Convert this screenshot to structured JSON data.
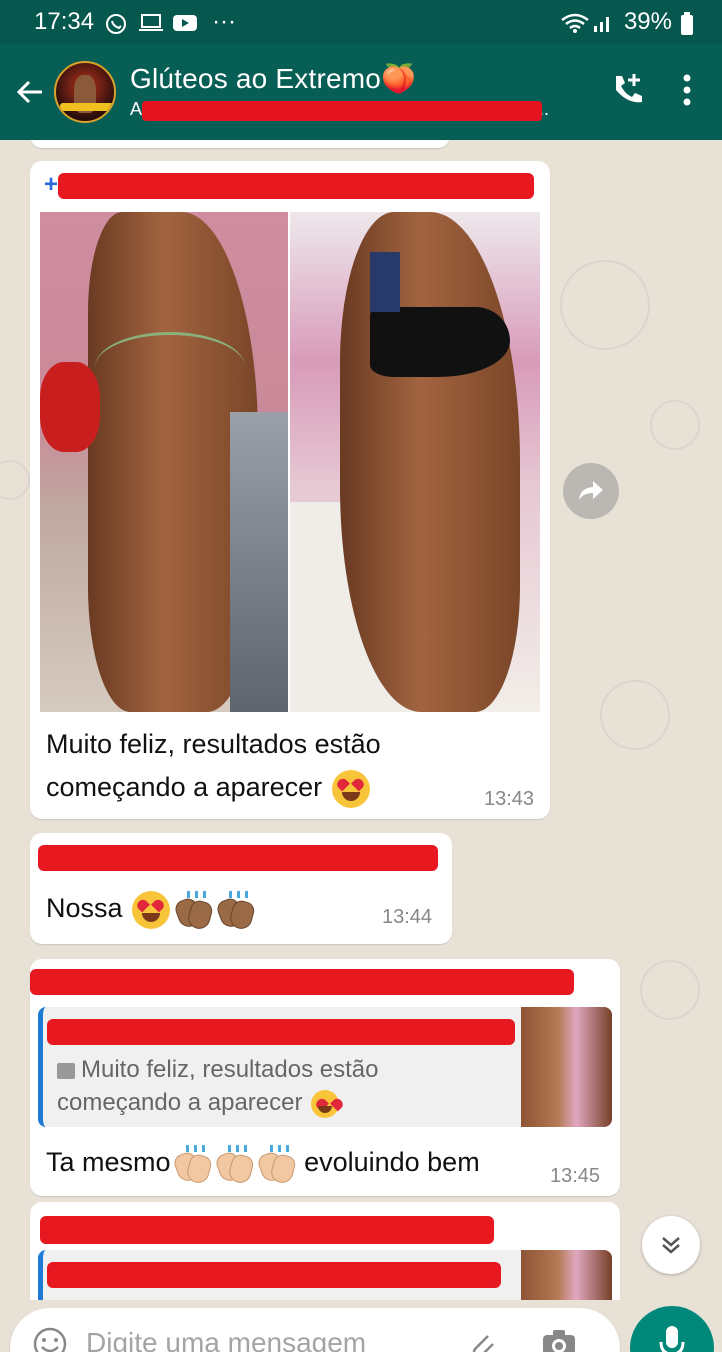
{
  "status_bar": {
    "time": "17:34",
    "battery": "39%",
    "notification_icons": [
      "whatsapp-icon",
      "laptop-icon",
      "youtube-icon"
    ],
    "more": "···"
  },
  "header": {
    "title": "Glúteos ao Extremo🍑",
    "subtitle": "At",
    "subtitle_tail": ", ...",
    "colors": {
      "bar": "#075e54",
      "status": "#06574d"
    }
  },
  "messages": [
    {
      "type": "image",
      "sender_prefix": "+",
      "caption_line1": "Muito feliz, resultados estão",
      "caption_line2": "começando a aparecer",
      "time": "13:43"
    },
    {
      "type": "text",
      "text": "Nossa",
      "time": "13:44"
    },
    {
      "type": "reply",
      "quote_line1": "Muito feliz, resultados estão",
      "quote_line2": "começando a aparecer",
      "text_before": "Ta mesmo",
      "text_after": "evoluindo bem",
      "time": "13:45"
    }
  ],
  "composer": {
    "placeholder": "Digite uma mensagem"
  },
  "colors": {
    "chat_bg": "#e8e1d6",
    "redaction": "#e71820",
    "mic_button": "#00897b",
    "quote_border": "#1f7ad6"
  }
}
